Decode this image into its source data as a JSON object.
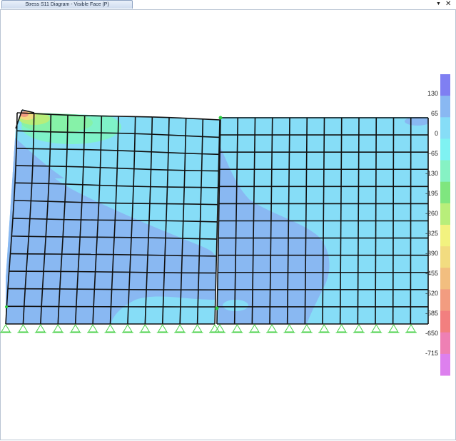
{
  "window": {
    "tab_title": "Stress S11 Diagram - Visible Face   (P)",
    "menu_icon": "triangle-down-icon",
    "close_icon": "close-x-icon"
  },
  "legend": {
    "labels": [
      "130",
      "65",
      "0",
      "-65",
      "-130",
      "-195",
      "-260",
      "-325",
      "-390",
      "-455",
      "-520",
      "-585",
      "-650",
      "-715"
    ],
    "colors": [
      "#7f7ff2",
      "#89b8f2",
      "#86ddf7",
      "#7ff2f2",
      "#86f2c4",
      "#7fe67f",
      "#b8ee7a",
      "#f2f27f",
      "#f2dc80",
      "#f2be7f",
      "#f29c80",
      "#f27f7f",
      "#ee80b4",
      "#dd80ee"
    ]
  },
  "model": {
    "left_wall": {
      "cols": 12,
      "rows": 12
    },
    "right_wall": {
      "cols": 12,
      "rows": 12
    },
    "support_icon": "pin-support-icon",
    "support_count": 24
  }
}
